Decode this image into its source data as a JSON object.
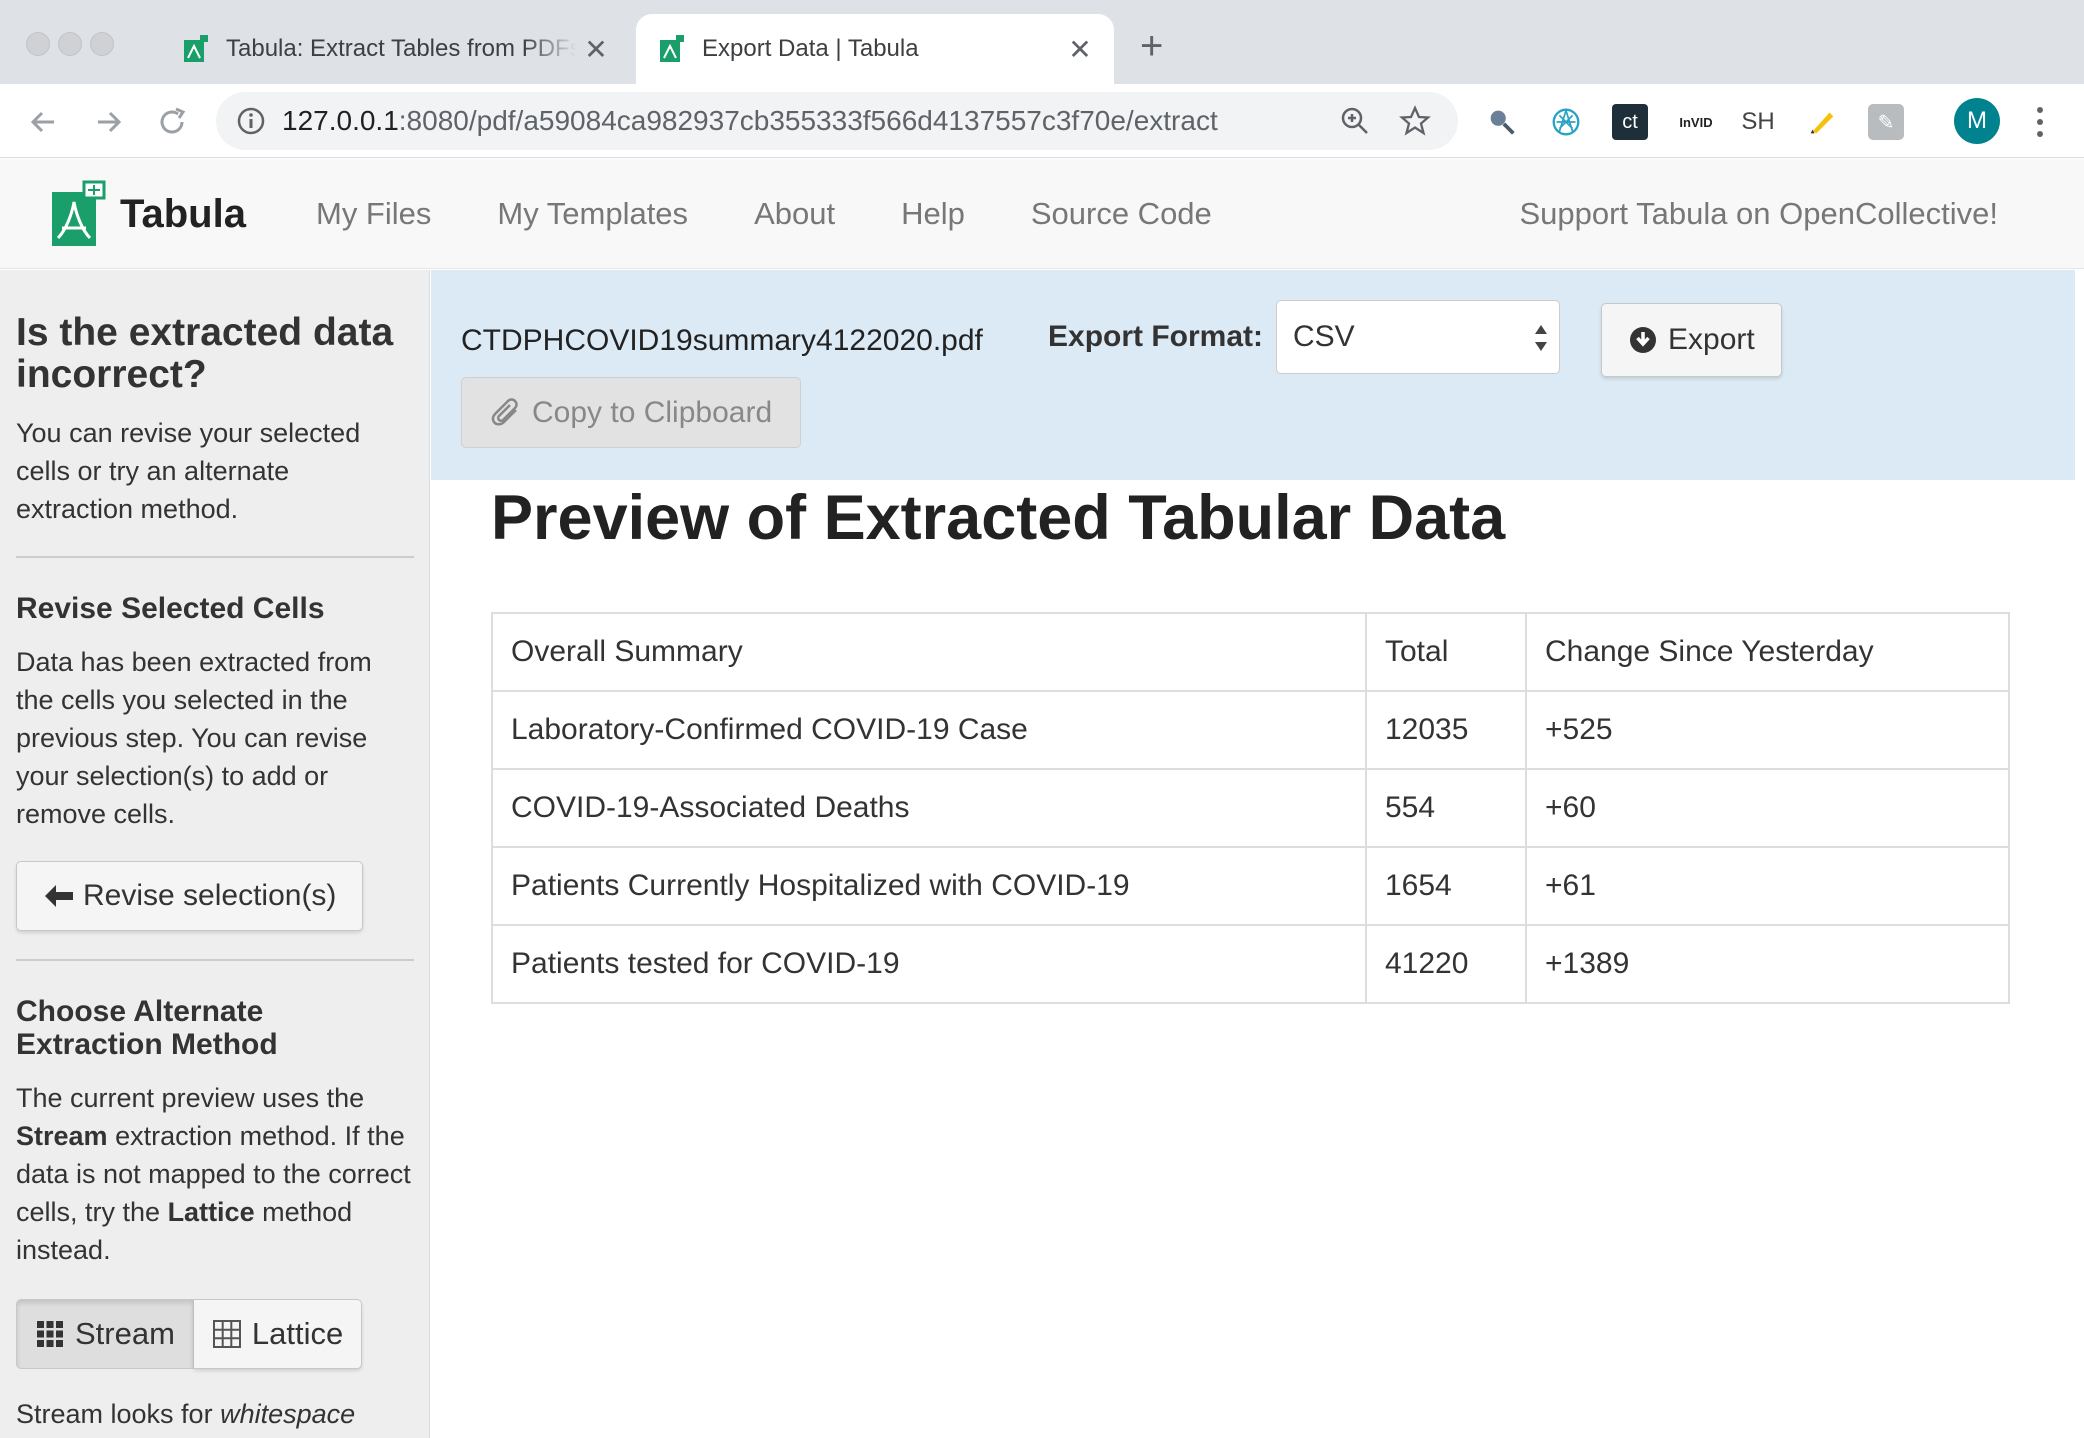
{
  "browser": {
    "tabs": [
      {
        "title": "Tabula: Extract Tables from PDFs",
        "active": false
      },
      {
        "title": "Export Data | Tabula",
        "active": true
      }
    ],
    "url_host": "127.0.0.1",
    "url_path": ":8080/pdf/a59084ca982937cb355333f566d4137557c3f70e/extract",
    "extension_labels": {
      "invid": "InVID",
      "sh": "SH",
      "ct": "ct"
    },
    "avatar_initial": "M"
  },
  "navbar": {
    "brand": "Tabula",
    "links": [
      "My Files",
      "My Templates",
      "About",
      "Help",
      "Source Code"
    ],
    "support": "Support Tabula on OpenCollective!"
  },
  "sidebar": {
    "heading": "Is the extracted data incorrect?",
    "intro": "You can revise your selected cells or try an alternate extraction method.",
    "revise_heading": "Revise Selected Cells",
    "revise_text": "Data has been extracted from the cells you selected in the previous step. You can revise your selection(s) to add or remove cells.",
    "revise_button": "Revise selection(s)",
    "alt_heading": "Choose Alternate Extraction Method",
    "alt_text_1": "The current preview uses the",
    "alt_text_bold1": "Stream",
    "alt_text_2": "extraction method. If the data is not mapped to the correct cells, try the",
    "alt_text_bold2": "Lattice",
    "alt_text_3": "method instead.",
    "stream_label": "Stream",
    "lattice_label": "Lattice",
    "stream_desc_1": "Stream looks for",
    "stream_desc_italic": "whitespace"
  },
  "export": {
    "filename": "CTDPHCOVID19summary4122020.pdf",
    "format_label": "Export Format:",
    "format_value": "CSV",
    "export_button": "Export",
    "copy_button": "Copy to Clipboard"
  },
  "preview": {
    "title": "Preview of Extracted Tabular Data",
    "rows": [
      [
        "Overall Summary",
        "Total",
        "Change Since Yesterday"
      ],
      [
        "Laboratory-Confirmed COVID-19 Case",
        "12035",
        "+525"
      ],
      [
        "COVID-19-Associated Deaths",
        "554",
        "+60"
      ],
      [
        "Patients Currently Hospitalized with COVID-19",
        "1654",
        "+61"
      ],
      [
        "Patients tested for COVID-19",
        "41220",
        "+1389"
      ]
    ]
  },
  "colors": {
    "brand_green": "#1a9e6a",
    "export_bar": "#dbeaf5",
    "sidebar_bg": "#eeeeee"
  }
}
